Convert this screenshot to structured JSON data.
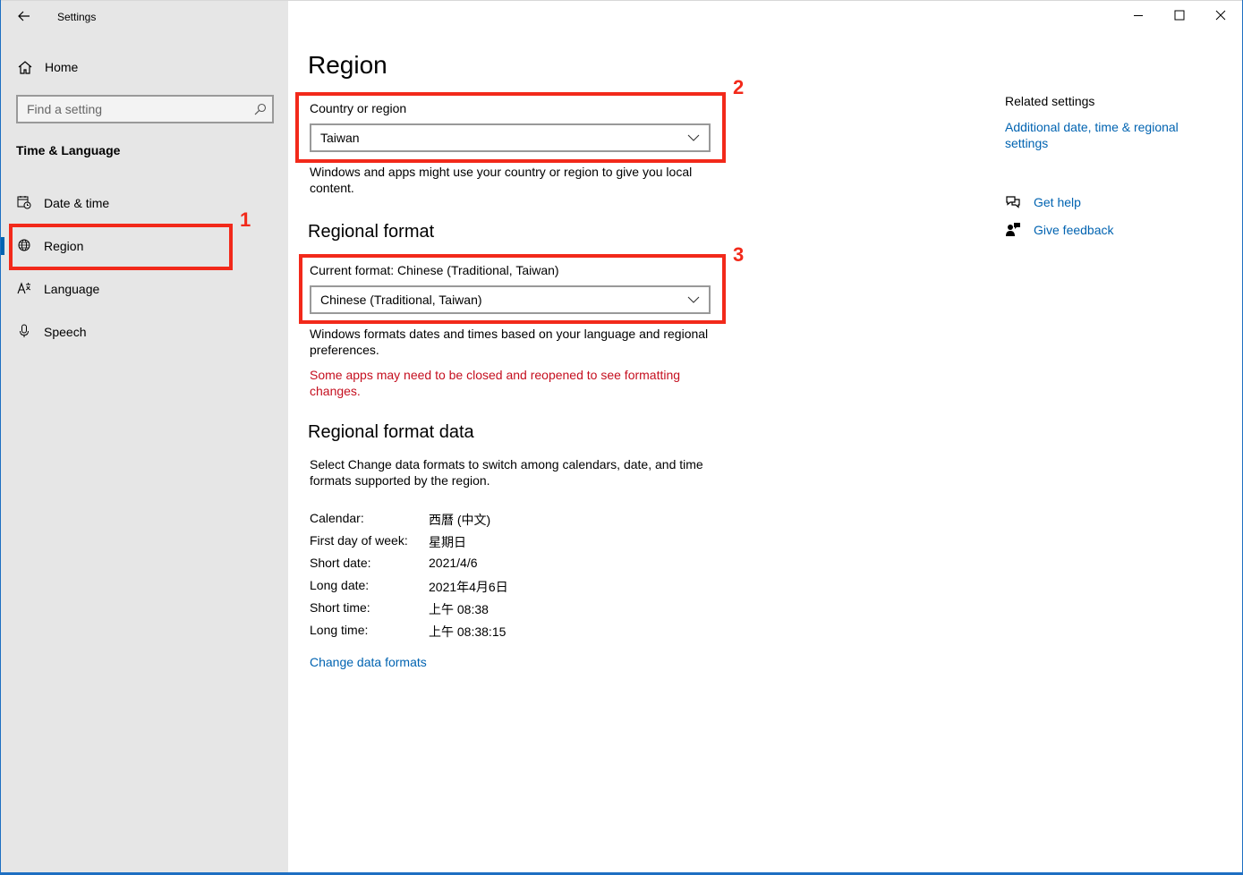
{
  "window": {
    "title": "Settings"
  },
  "sidebar": {
    "home": "Home",
    "search_placeholder": "Find a setting",
    "section": "Time & Language",
    "items": [
      {
        "label": "Date & time",
        "icon": "calendar-clock-icon"
      },
      {
        "label": "Region",
        "icon": "globe-icon",
        "selected": true
      },
      {
        "label": "Language",
        "icon": "language-icon"
      },
      {
        "label": "Speech",
        "icon": "microphone-icon"
      }
    ]
  },
  "annotations": [
    "1",
    "2",
    "3"
  ],
  "main": {
    "title": "Region",
    "country": {
      "label": "Country or region",
      "value": "Taiwan",
      "description": "Windows and apps might use your country or region to give you local content."
    },
    "regional_format": {
      "heading": "Regional format",
      "label": "Current format: Chinese (Traditional, Taiwan)",
      "value": "Chinese (Traditional, Taiwan)",
      "description": "Windows formats dates and times based on your language and regional preferences.",
      "warning": "Some apps may need to be closed and reopened to see formatting changes."
    },
    "format_data": {
      "heading": "Regional format data",
      "description": "Select Change data formats to switch among calendars, date, and time formats supported by the region.",
      "rows": [
        {
          "key": "Calendar:",
          "value": "西曆 (中文)"
        },
        {
          "key": "First day of week:",
          "value": "星期日"
        },
        {
          "key": "Short date:",
          "value": "2021/4/6"
        },
        {
          "key": "Long date:",
          "value": "2021年4月6日"
        },
        {
          "key": "Short time:",
          "value": "上午 08:38"
        },
        {
          "key": "Long time:",
          "value": "上午 08:38:15"
        }
      ],
      "change_link": "Change data formats"
    }
  },
  "related": {
    "title": "Related settings",
    "link": "Additional date, time & regional settings",
    "help": "Get help",
    "feedback": "Give feedback"
  },
  "colors": {
    "accent": "#0063b1",
    "annotation": "#f2291a",
    "warning": "#c50f1f",
    "sidebar_bg": "#e6e6e6"
  }
}
